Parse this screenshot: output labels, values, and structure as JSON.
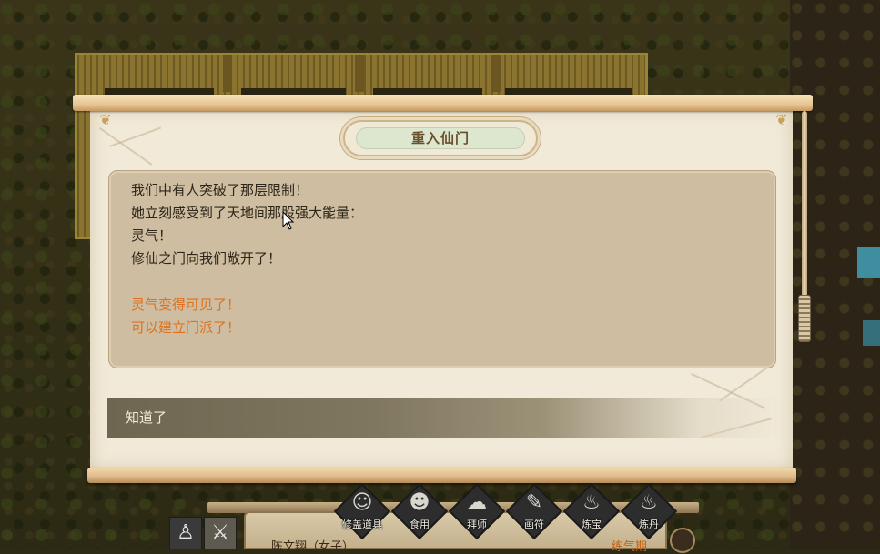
{
  "dialog": {
    "title": "重入仙门",
    "lines": [
      {
        "text": "我们中有人突破了那层限制！",
        "color": "#2e2618"
      },
      {
        "text": "她立刻感受到了天地间那股强大能量：",
        "color": "#2e2618"
      },
      {
        "text": "灵气！",
        "color": "#2e2618"
      },
      {
        "text": "修仙之门向我们敞开了！",
        "color": "#2e2618"
      },
      {
        "text": "灵气变得可见了！",
        "color": "#e0701e"
      },
      {
        "text": "可以建立门派了！",
        "color": "#e0701e"
      }
    ],
    "ack_button": "知道了"
  },
  "hud": {
    "actions": [
      {
        "label": "修盖道具",
        "icon": "figure-icon"
      },
      {
        "label": "食用",
        "icon": "eat-icon"
      },
      {
        "label": "拜师",
        "icon": "bow-icon"
      },
      {
        "label": "画符",
        "icon": "brush-icon"
      },
      {
        "label": "炼宝",
        "icon": "cauldron-icon"
      },
      {
        "label": "炼丹",
        "icon": "pill-furnace-icon"
      }
    ],
    "character_name": "陈文翔（女子）",
    "character_status": "练气期"
  },
  "colors": {
    "paper": "#f1ead9",
    "message_panel": "#cebda1",
    "highlight_text": "#e0701e",
    "ack_bar": "#807760"
  }
}
